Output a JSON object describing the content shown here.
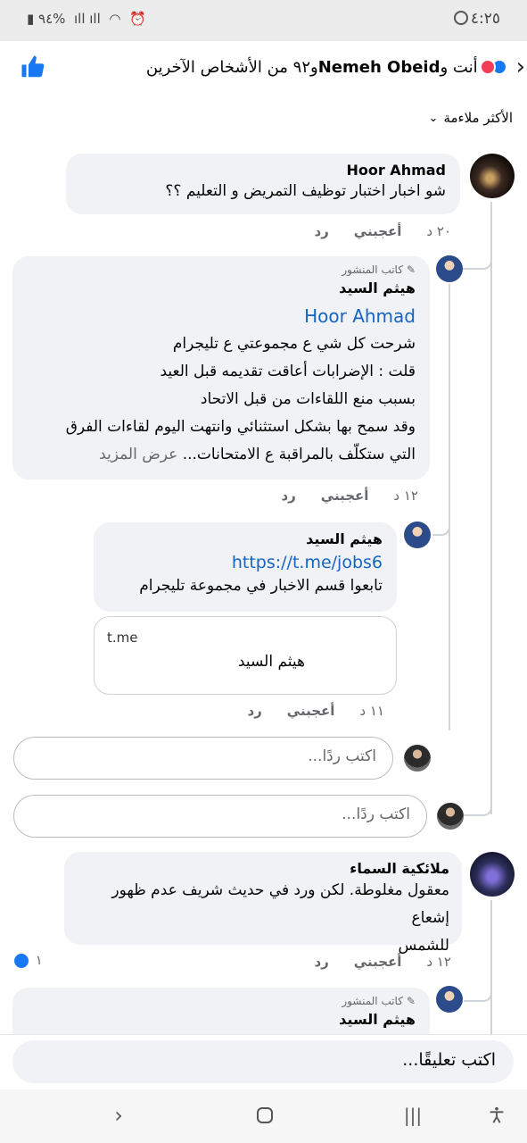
{
  "status_bar": {
    "time": "٤:٢٥",
    "battery": "٩٤%"
  },
  "header": {
    "reactors_text": "أنت و",
    "reactor_name": "Nemeh Obeid",
    "others_text": "و٩٢ من الأشخاص الآخرين"
  },
  "sort": {
    "label": "الأكثر ملاءمة"
  },
  "comments": [
    {
      "author": "Hoor Ahmad",
      "text": "شو اخبار اختبار توظيف التمريض و التعليم ؟؟",
      "time": "٢٠ د",
      "like_label": "أعجبني",
      "reply_label": "رد"
    },
    {
      "author_tag": "كاتب المنشور",
      "author": "هيثم السيد",
      "mention": "Hoor Ahmad",
      "lines": [
        "شرحت كل شي ع مجموعتي ع تليجرام",
        "قلت : الإضرابات أعاقت تقديمه قبل العيد",
        "بسبب منع اللقاءات من قبل الاتحاد",
        "وقد سمح بها بشكل استثنائي وانتهت اليوم لقاءات الفرق",
        "التي ستكلّف بالمراقبة ع الامتحانات..."
      ],
      "see_more": "عرض المزيد",
      "time": "١٢ د",
      "like_label": "أعجبني",
      "reply_label": "رد"
    },
    {
      "author": "هيثم السيد",
      "link": "https://t.me/jobs6",
      "text": "تابعوا قسم الاخبار في مجموعة تليجرام",
      "preview_domain": "t.me",
      "preview_title": "هيثم السيد",
      "time": "١١ د",
      "like_label": "أعجبني",
      "reply_label": "رد"
    },
    {
      "author": "ملائكية السماء",
      "lines": [
        "معقول مغلوطة. لكن ورد في حديث شريف عدم ظهور إشعاع",
        "للشمس"
      ],
      "time": "١٢ د",
      "like_label": "أعجبني",
      "reply_label": "رد",
      "likes": "١"
    },
    {
      "author_tag": "كاتب المنشور",
      "author": "هيثم السيد"
    }
  ],
  "reply_placeholder": "اكتب ردًا...",
  "composer_placeholder": "اكتب تعليقًا..."
}
